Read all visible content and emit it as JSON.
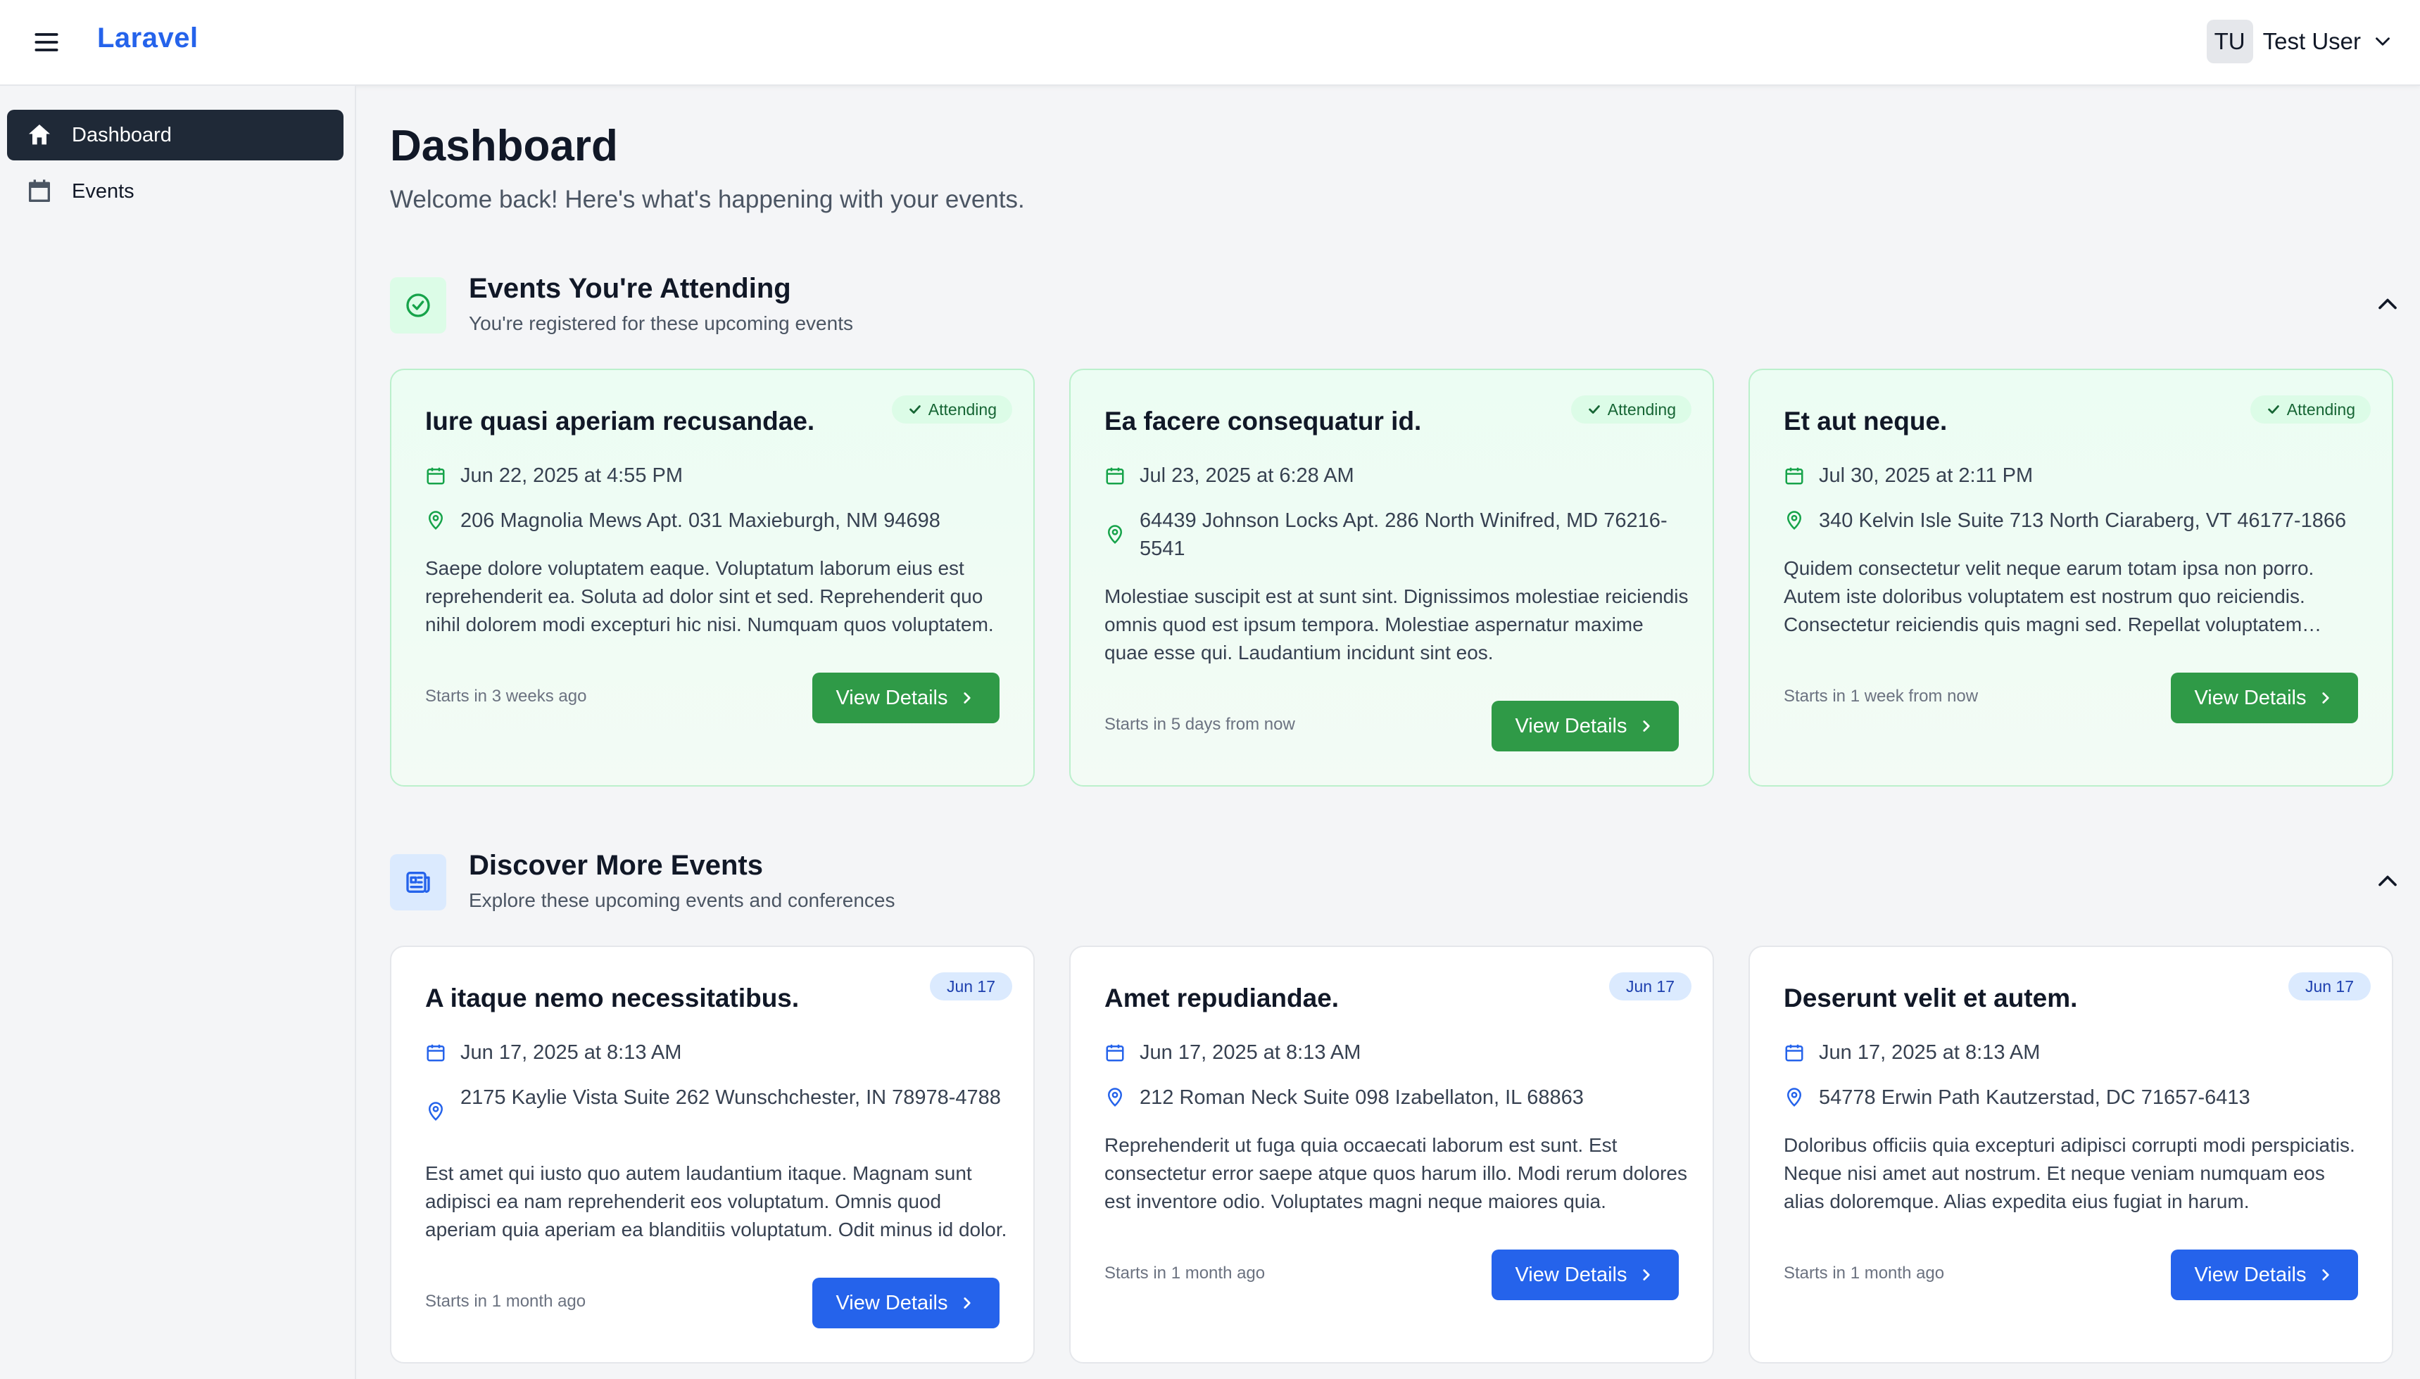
{
  "app": {
    "brand": "Laravel",
    "user": {
      "initials": "TU",
      "name": "Test User"
    }
  },
  "sidebar": {
    "items": [
      {
        "label": "Dashboard",
        "icon": "home-icon",
        "active": true
      },
      {
        "label": "Events",
        "icon": "calendar-icon",
        "active": false
      }
    ]
  },
  "page": {
    "title": "Dashboard",
    "subtitle": "Welcome back! Here's what's happening with your events."
  },
  "attending": {
    "title": "Events You're Attending",
    "subtitle": "You're registered for these upcoming events",
    "badge_label": "Attending",
    "button_label": "View Details",
    "cards": [
      {
        "title": "Iure quasi aperiam recusandae.",
        "date": "Jun 22, 2025 at 4:55 PM",
        "location": "206 Magnolia Mews Apt. 031 Maxieburgh, NM 94698",
        "description": "Saepe dolore voluptatem eaque. Voluptatum laborum eius est reprehenderit ea. Soluta ad dolor sint et sed. Reprehenderit quo nihil dolorem modi excepturi hic nisi. Numquam quos voluptatem.",
        "starts": "Starts in 3 weeks ago"
      },
      {
        "title": "Ea facere consequatur id.",
        "date": "Jul 23, 2025 at 6:28 AM",
        "location": "64439 Johnson Locks Apt. 286 North Winifred, MD 76216-5541",
        "description": "Molestiae suscipit est at sunt sint. Dignissimos molestiae reiciendis omnis quod est ipsum tempora. Molestiae aspernatur maxime quae esse qui. Laudantium incidunt sint eos.",
        "starts": "Starts in 5 days from now"
      },
      {
        "title": "Et aut neque.",
        "date": "Jul 30, 2025 at 2:11 PM",
        "location": "340 Kelvin Isle Suite 713 North Ciaraberg, VT 46177-1866",
        "description": "Quidem consectetur velit neque earum totam ipsa non porro. Autem iste doloribus voluptatem est nostrum quo reiciendis. Consectetur reiciendis quis magni sed. Repellat voluptatem voluptas.",
        "starts": "Starts in 1 week from now"
      }
    ]
  },
  "discover": {
    "title": "Discover More Events",
    "subtitle": "Explore these upcoming events and conferences",
    "button_label": "View Details",
    "cards": [
      {
        "title": "A itaque nemo necessitatibus.",
        "badge": "Jun 17",
        "date": "Jun 17, 2025 at 8:13 AM",
        "location": "2175 Kaylie Vista Suite 262 Wunschchester, IN 78978-4788",
        "description": "Est amet qui iusto quo autem laudantium itaque. Magnam sunt adipisci ea nam reprehenderit eos voluptatum. Omnis quod aperiam quia aperiam ea blanditiis voluptatum. Odit minus id dolor.",
        "starts": "Starts in 1 month ago"
      },
      {
        "title": "Amet repudiandae.",
        "badge": "Jun 17",
        "date": "Jun 17, 2025 at 8:13 AM",
        "location": "212 Roman Neck Suite 098 Izabellaton, IL 68863",
        "description": "Reprehenderit ut fuga quia occaecati laborum est sunt. Est consectetur error saepe atque quos harum illo. Modi rerum dolores est inventore odio. Voluptates magni neque maiores quia.",
        "starts": "Starts in 1 month ago"
      },
      {
        "title": "Deserunt velit et autem.",
        "badge": "Jun 17",
        "date": "Jun 17, 2025 at 8:13 AM",
        "location": "54778 Erwin Path Kautzerstad, DC 71657-6413",
        "description": "Doloribus officiis quia excepturi adipisci corrupti modi perspiciatis. Neque nisi amet aut nostrum. Et neque veniam numquam eos alias doloremque. Alias expedita eius fugiat in harum.",
        "starts": "Starts in 1 month ago"
      }
    ]
  },
  "colors": {
    "brand": "#2563eb",
    "attending_button": "#2f9a47",
    "discover_button": "#2563eb",
    "sidebar_active": "#1f2937"
  }
}
